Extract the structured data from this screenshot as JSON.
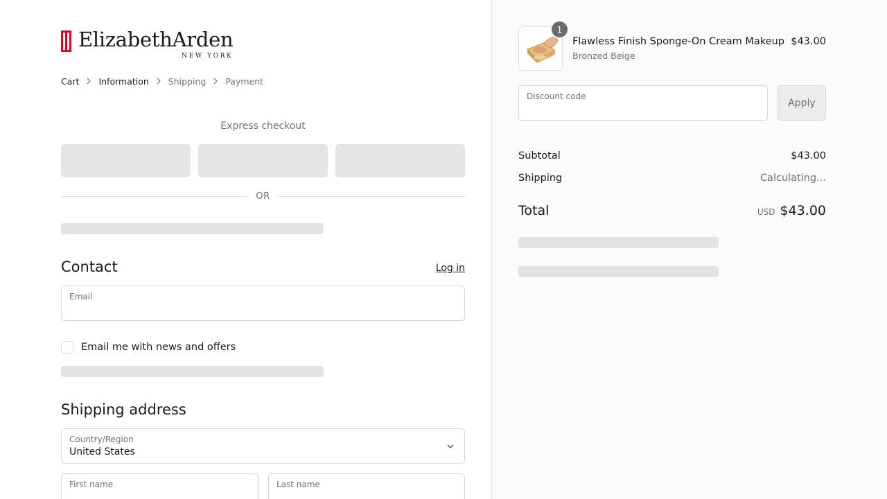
{
  "brand": {
    "name": "ElizabethArden",
    "subline": "NEW YORK",
    "color": "#c8102e"
  },
  "breadcrumb": [
    {
      "label": "Cart"
    },
    {
      "label": "Information"
    },
    {
      "label": "Shipping"
    },
    {
      "label": "Payment"
    }
  ],
  "express": {
    "title": "Express checkout",
    "divider": "OR"
  },
  "contact": {
    "title": "Contact",
    "login_label": "Log in",
    "email_label": "Email",
    "email_value": "",
    "newsletter_label": "Email me with news and offers"
  },
  "shipping_address": {
    "title": "Shipping address",
    "country_label": "Country/Region",
    "country_value": "United States",
    "first_name_label": "First name",
    "last_name_label": "Last name"
  },
  "order": {
    "item": {
      "name": "Flawless Finish Sponge-On Cream Makeup",
      "variant": "Bronzed Beige",
      "price": "$43.00",
      "quantity": "1"
    },
    "discount_label": "Discount code",
    "apply_label": "Apply",
    "subtotal_label": "Subtotal",
    "subtotal_value": "$43.00",
    "shipping_label": "Shipping",
    "shipping_value": "Calculating...",
    "total_label": "Total",
    "currency": "USD",
    "total_value": "$43.00"
  }
}
